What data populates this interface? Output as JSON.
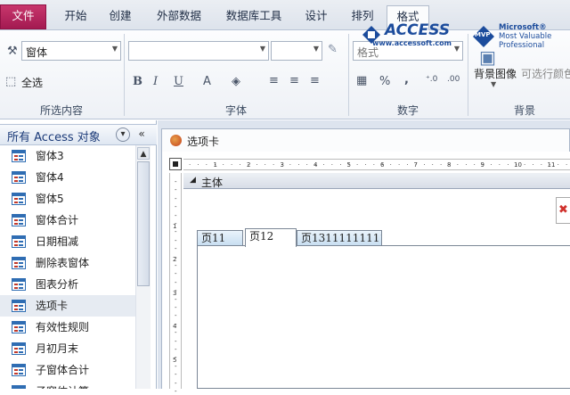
{
  "tabs": {
    "file": "文件",
    "items": [
      "开始",
      "创建",
      "外部数据",
      "数据库工具",
      "设计",
      "排列",
      "格式"
    ],
    "active_index": 6
  },
  "ribbon": {
    "selection": {
      "object_combo": "窗体",
      "select_all": "全选",
      "group_label": "所选内容"
    },
    "font": {
      "font_combo": "",
      "size_combo": "",
      "group_label": "字体",
      "bold": "B",
      "italic": "I",
      "underline": "U",
      "font_color": "A"
    },
    "number": {
      "format_combo": "格式",
      "percent": "%",
      "comma": ",",
      "group_label": "数字"
    },
    "background": {
      "bg_image": "背景图像",
      "alt_row": "可选行颜色",
      "group_label": "背景"
    },
    "logo": {
      "brand": "ACCESS",
      "url": "www.accessoft.com",
      "mvp_badge": "MVP",
      "mvp_line1": "Microsoft®",
      "mvp_line2": "Most Valuable",
      "mvp_line3": "Professional"
    }
  },
  "nav": {
    "title": "所有 Access 对象",
    "items": [
      "窗体3",
      "窗体4",
      "窗体5",
      "窗体合计",
      "日期相减",
      "删除表窗体",
      "图表分析",
      "选项卡",
      "有效性规则",
      "月初月末",
      "子窗体合计",
      "子窗体计算"
    ],
    "selected_index": 7
  },
  "document": {
    "tab_title": "选项卡",
    "section_label": "主体",
    "ruler_h": [
      "1",
      "2",
      "3",
      "4",
      "5",
      "6",
      "7",
      "8",
      "9",
      "10",
      "11"
    ],
    "ruler_v": [
      "1",
      "2",
      "3",
      "4",
      "5"
    ],
    "form_tabs": [
      "页11",
      "页12",
      "页13111111111"
    ],
    "form_tab_active": 1
  },
  "colors": {
    "file_tab": "#b3245d",
    "nav_title": "#1b3a78",
    "accent_blue": "#2f6db3"
  }
}
